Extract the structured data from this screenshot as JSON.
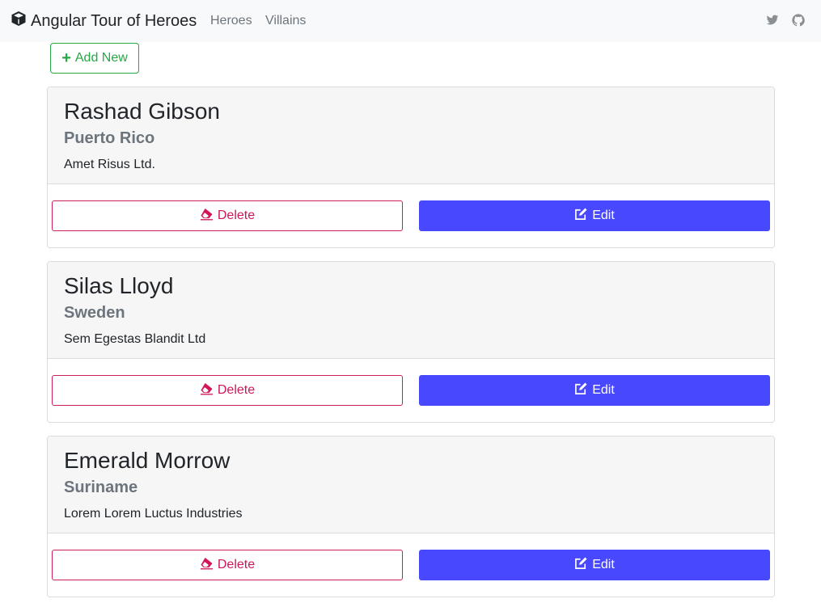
{
  "navbar": {
    "brand": "Angular Tour of Heroes",
    "brand_icon": "cube-icon",
    "links": [
      "Heroes",
      "Villains"
    ],
    "social_icons": [
      "twitter-icon",
      "github-icon"
    ]
  },
  "toolbar": {
    "add_label": "Add New",
    "add_icon": "plus-icon"
  },
  "cards": [
    {
      "name": "Rashad Gibson",
      "country": "Puerto Rico",
      "company": "Amet Risus Ltd.",
      "delete_label": "Delete",
      "edit_label": "Edit"
    },
    {
      "name": "Silas Lloyd",
      "country": "Sweden",
      "company": "Sem Egestas Blandit Ltd",
      "delete_label": "Delete",
      "edit_label": "Edit"
    },
    {
      "name": "Emerald Morrow",
      "country": "Suriname",
      "company": "Lorem Lorem Luctus Industries",
      "delete_label": "Delete",
      "edit_label": "Edit"
    }
  ],
  "colors": {
    "success": "#28a745",
    "danger": "#d1155a",
    "primary": "#4848ff",
    "navbar_bg": "#f8f9fa"
  }
}
